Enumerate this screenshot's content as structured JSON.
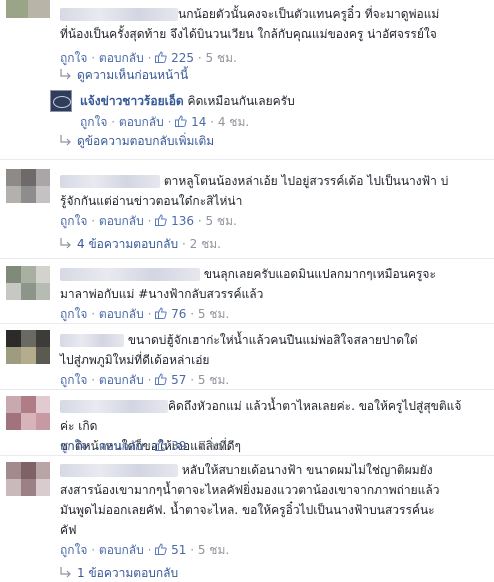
{
  "thread": {
    "prev_comments_label": "ดูความเห็นก่อนหน้านี้",
    "more_replies_label": "ดูข้อความตอบกลับเพิ่มเติม",
    "like_label": "ถูกใจ",
    "reply_label": "ตอบกลับ",
    "dot": "·"
  },
  "comments": [
    {
      "lines": [
        "นกน้อยตัวนั้นคงจะเป็นตัวแทนครูอิ๋ว ที่จะมาดูพ่อแม่",
        "ที่น้องเป็นครั้งสุดท้าย จึงได้บินวนเวียน ใกล้กับคุณแม่ของครู น่าอัศจรรย์ใจ"
      ],
      "likes": "225",
      "time": "5 ชม."
    },
    {
      "author": "แจ้งข่าวชาวร้อยเอ็ด",
      "text": "คิดเหมือนกันเลยครับ",
      "likes": "14",
      "time": "4 ชม."
    },
    {
      "lines": [
        "ตาหลูโตนน้องหล่าเอ้ย ไปอยู่สวรรค์เด้อ ไปเป็นนางฟ้า บ่",
        "รู้จักกันแต่อ่านข่าวตอนใด๋กะสิไห่น่า"
      ],
      "likes": "136",
      "time": "5 ชม.",
      "replies": "4 ข้อความตอบกลับ",
      "replies_time": "2 ชม."
    },
    {
      "lines": [
        "ขนลุกเลยครับแอดมินแปลกมากๆเหมือนครูจะ",
        "มาลาพ่อกับแม่ #นางฟ้ากลับสวรรค์แล้ว"
      ],
      "likes": "76",
      "time": "5 ชม."
    },
    {
      "lines": [
        "ขนาดบ่ฮู้จักเฮาก่ะให่น้ำแล้วคนปืนแม่พ่อสิใจสลายปาดใด่",
        "ไปสู่ภพภูมิใหม่ที่ดีเด้อหล่าเอ่ย"
      ],
      "likes": "57",
      "time": "5 ชม."
    },
    {
      "lines": [
        "คิดถึงหัวอกแม่ แล้วน้ำตาไหลเลยค่ะ. ขอให้ครูไปสู่สุขติแจ้ค่ะ เกิด",
        "ชาติหน้าหนใดก็ขอให้เจอแต่สิ่งที่ดีๆ"
      ],
      "likes": "39",
      "time": "5 ชม."
    },
    {
      "lines": [
        "หลับให้สบายเด้อนางฟ้า ขนาดผมไม่ใช่ญาติผมยัง",
        "สงสารน้องเขามากๆน้ำตาจะไหลคัฟยิ่งมองแววตาน้องเขาจากภาพถ่ายแล้ว",
        "มันพูดไม่ออกเลยคัฟ. น้ำตาจะไหล. ขอให้ครูอิ๋วไปเป็นนางฟ้าบนสวรรค์นะ",
        "คัฟ"
      ],
      "likes": "51",
      "time": "5 ชม.",
      "replies": "1 ข้อความตอบกลับ"
    }
  ],
  "colors": {
    "link": "#365899",
    "meta": "#90949c",
    "text": "#1d2129",
    "divider": "#e9ebee"
  },
  "icons": {
    "like": "like-thumb-icon",
    "reply_arrow": "reply-arrow-icon"
  }
}
